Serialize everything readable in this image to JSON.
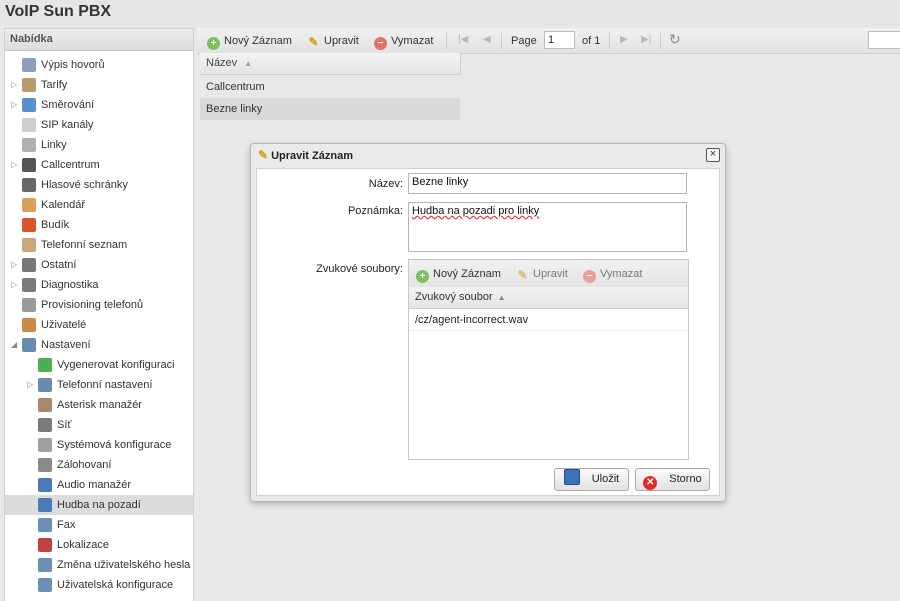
{
  "app": {
    "title": "VoIP Sun PBX"
  },
  "menu": {
    "title": "Nabídka",
    "items": [
      {
        "label": "Výpis hovorů",
        "icon": "report-icon",
        "color": "#8aa0b8",
        "expandable": false,
        "level": 0
      },
      {
        "label": "Tarify",
        "icon": "tariff-icon",
        "color": "#b89b6a",
        "expandable": true,
        "level": 0
      },
      {
        "label": "Směrování",
        "icon": "routing-icon",
        "color": "#5a8fd0",
        "expandable": true,
        "level": 0
      },
      {
        "label": "SIP kanály",
        "icon": "sip-icon",
        "color": "#cfcfcf",
        "expandable": false,
        "level": 0
      },
      {
        "label": "Linky",
        "icon": "lines-icon",
        "color": "#b0b0b0",
        "expandable": false,
        "level": 0
      },
      {
        "label": "Callcentrum",
        "icon": "headset-icon",
        "color": "#555555",
        "expandable": true,
        "level": 0
      },
      {
        "label": "Hlasové schránky",
        "icon": "voicemail-icon",
        "color": "#666666",
        "expandable": false,
        "level": 0
      },
      {
        "label": "Kalendář",
        "icon": "calendar-icon",
        "color": "#d8a05a",
        "expandable": false,
        "level": 0
      },
      {
        "label": "Budík",
        "icon": "alarm-clock-icon",
        "color": "#d9542b",
        "expandable": false,
        "level": 0
      },
      {
        "label": "Telefonní seznam",
        "icon": "phonebook-icon",
        "color": "#c8a87a",
        "expandable": false,
        "level": 0
      },
      {
        "label": "Ostatní",
        "icon": "other-icon",
        "color": "#777777",
        "expandable": true,
        "level": 0
      },
      {
        "label": "Diagnostika",
        "icon": "diagnostics-icon",
        "color": "#7a7a7a",
        "expandable": true,
        "level": 0
      },
      {
        "label": "Provisioning telefonů",
        "icon": "provisioning-icon",
        "color": "#9a9a9a",
        "expandable": false,
        "level": 0
      },
      {
        "label": "Uživatelé",
        "icon": "users-icon",
        "color": "#c98a4a",
        "expandable": false,
        "level": 0
      },
      {
        "label": "Nastavení",
        "icon": "wrench-icon",
        "color": "#6a8ab0",
        "expandable": true,
        "expanded": true,
        "level": 0
      },
      {
        "label": "Vygenerovat konfiguraci",
        "icon": "check-icon",
        "color": "#4caf50",
        "expandable": false,
        "level": 1
      },
      {
        "label": "Telefonní nastavení",
        "icon": "wrench-icon",
        "color": "#6a8ab0",
        "expandable": true,
        "level": 1
      },
      {
        "label": "Asterisk manažér",
        "icon": "asterisk-icon",
        "color": "#a88a6a",
        "expandable": false,
        "level": 1
      },
      {
        "label": "Síť",
        "icon": "network-icon",
        "color": "#7a7a7a",
        "expandable": false,
        "level": 1
      },
      {
        "label": "Systémová konfigurace",
        "icon": "server-icon",
        "color": "#a0a0a0",
        "expandable": false,
        "level": 1
      },
      {
        "label": "Zálohovaní",
        "icon": "backup-icon",
        "color": "#8a8a8a",
        "expandable": false,
        "level": 1
      },
      {
        "label": "Audio manažér",
        "icon": "music-icon",
        "color": "#4a7ab8",
        "expandable": false,
        "level": 1
      },
      {
        "label": "Hudba na pozadí",
        "icon": "music-icon",
        "color": "#4a7ab8",
        "expandable": false,
        "level": 1,
        "selected": true
      },
      {
        "label": "Fax",
        "icon": "fax-icon",
        "color": "#6a90b8",
        "expandable": false,
        "level": 1
      },
      {
        "label": "Lokalizace",
        "icon": "flag-icon",
        "color": "#c04040",
        "expandable": false,
        "level": 1
      },
      {
        "label": "Změna uživatelského hesla",
        "icon": "form-icon",
        "color": "#6a90b8",
        "expandable": false,
        "level": 1
      },
      {
        "label": "Uživatelská konfigurace",
        "icon": "form-icon",
        "color": "#6a90b8",
        "expandable": false,
        "level": 1
      }
    ]
  },
  "toolbar": {
    "add_label": "Nový Záznam",
    "edit_label": "Upravit",
    "delete_label": "Vymazat",
    "page_label": "Page",
    "page_value": "1",
    "of_label": "of 1"
  },
  "grid": {
    "column": "Název",
    "rows": [
      "Callcentrum",
      "Bezne linky"
    ],
    "selected_index": 1
  },
  "dialog": {
    "title": "Upravit Záznam",
    "close_symbol": "×",
    "name_label": "Název:",
    "name_value": "Bezne linky",
    "note_label": "Poznámka:",
    "note_value": "Hudba na pozadi pro linky",
    "files_label": "Zvukové soubory:",
    "sub_toolbar": {
      "add_label": "Nový Záznam",
      "edit_label": "Upravit",
      "delete_label": "Vymazat"
    },
    "sub_grid": {
      "column": "Zvukový soubor",
      "rows": [
        "/cz/agent-incorrect.wav"
      ]
    },
    "save_label": "Uložit",
    "cancel_label": "Storno"
  }
}
